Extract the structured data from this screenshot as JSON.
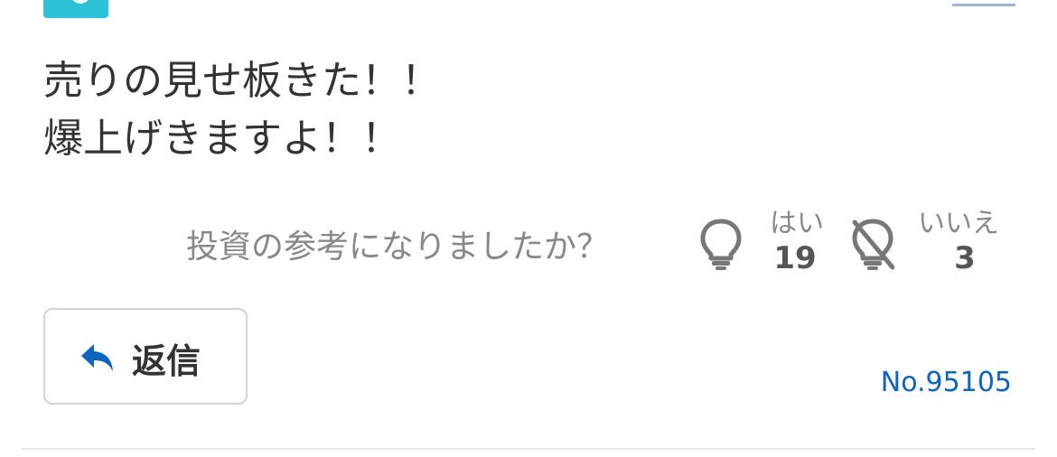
{
  "post": {
    "lines": [
      "売りの見せ板きた！！",
      "爆上げきますよ！！"
    ]
  },
  "vote": {
    "question": "投資の参考になりましたか？",
    "yes_label": "はい",
    "yes_count": "19",
    "no_label": "いいえ",
    "no_count": "3",
    "yes_icon": "lightbulb-icon",
    "no_icon": "lightbulb-off-icon"
  },
  "reply": {
    "label": "返信",
    "icon": "reply-arrow-icon",
    "icon_color": "#0c64c0"
  },
  "post_number": "No.95105",
  "colors": {
    "avatar": "#2cc3d6",
    "link": "#0c64c0",
    "muted_text": "#888888"
  }
}
